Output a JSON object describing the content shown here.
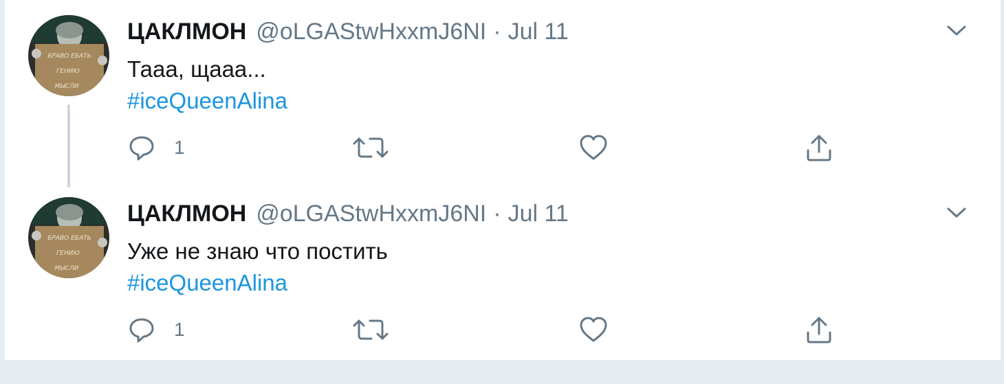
{
  "tweets": [
    {
      "author_name": "ЦАКЛМОН",
      "author_handle": "@oLGAStwHxxmJ6NI",
      "separator": "·",
      "date": "Jul 11",
      "text": "Тааа, щааа...",
      "hashtag": "#iceQueenAlina",
      "reply_count": "1",
      "avatar_lines": [
        "БРАВО ЕБАТЬ",
        "ГЕНИЮ",
        "МЫСЛИ"
      ]
    },
    {
      "author_name": "ЦАКЛМОН",
      "author_handle": "@oLGAStwHxxmJ6NI",
      "separator": "·",
      "date": "Jul 11",
      "text": "Уже не знаю что постить",
      "hashtag": "#iceQueenAlina",
      "reply_count": "1",
      "avatar_lines": [
        "БРАВО ЕБАТЬ",
        "ГЕНИЮ",
        "МЫСЛИ"
      ]
    }
  ],
  "icons": {
    "caret": "chevron-down-icon",
    "reply": "reply-icon",
    "retweet": "retweet-icon",
    "like": "heart-icon",
    "share": "share-icon"
  },
  "colors": {
    "text": "#14171a",
    "muted": "#657786",
    "link": "#1b95e0",
    "thread_line": "#ccd6dd",
    "background": "#e6ecf0"
  }
}
